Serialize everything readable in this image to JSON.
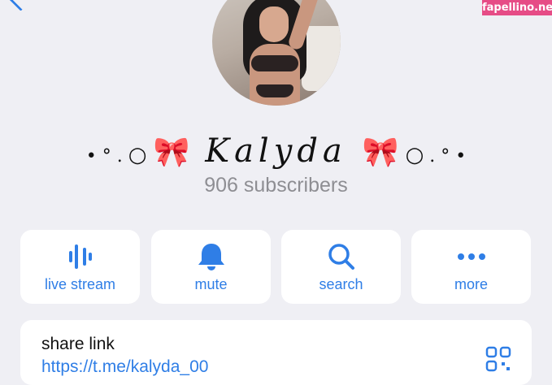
{
  "watermark": "fapellino.net",
  "profile": {
    "name_text": "Kalyda",
    "subscribers": "906 subscribers"
  },
  "actions": [
    {
      "label": "live stream",
      "icon": "voice-chat-icon"
    },
    {
      "label": "mute",
      "icon": "bell-icon"
    },
    {
      "label": "search",
      "icon": "search-icon"
    },
    {
      "label": "more",
      "icon": "more-dots-icon"
    }
  ],
  "share": {
    "title": "share link",
    "link": "https://t.me/kalyda_00"
  },
  "colors": {
    "accent": "#2f7ee6",
    "background": "#efeff4",
    "watermark": "#e64c86",
    "bow": "#e88ba6"
  }
}
